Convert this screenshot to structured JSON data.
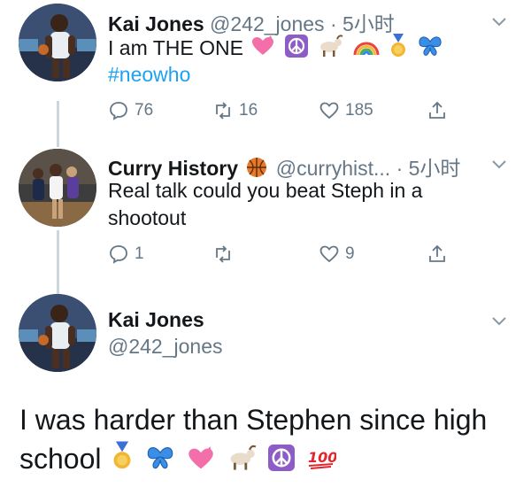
{
  "tweet1": {
    "name": "Kai Jones",
    "handle": "@242_jones",
    "sep": "·",
    "time": "5小时",
    "text": "I am THE ONE",
    "hashtag": "#neowho",
    "replies": "76",
    "retweets": "16",
    "likes": "185",
    "emoji_icons": [
      "heart-icon",
      "peace-icon",
      "goat-icon",
      "rainbow-icon",
      "medal-icon",
      "butterfly-icon"
    ]
  },
  "tweet2": {
    "name": "Curry History",
    "handle": "@curryhist...",
    "sep": "·",
    "time": "5小时",
    "text_line1": "Real talk could you beat Steph in a",
    "text_line2": "shootout",
    "replies": "1",
    "retweets": "",
    "likes": "9",
    "badge_icon": "basketball-icon"
  },
  "tweet3": {
    "name": "Kai Jones",
    "handle": "@242_jones",
    "text_line1": "I was harder than Stephen since high",
    "text_line2": "school",
    "emoji_icons": [
      "medal-icon",
      "butterfly-icon",
      "heart-icon",
      "goat-icon",
      "peace-icon",
      "hundred-icon"
    ]
  },
  "colors": {
    "text": "#14171a",
    "meta": "#657786",
    "link": "#1da1f2",
    "thread": "#ccd6dd"
  }
}
